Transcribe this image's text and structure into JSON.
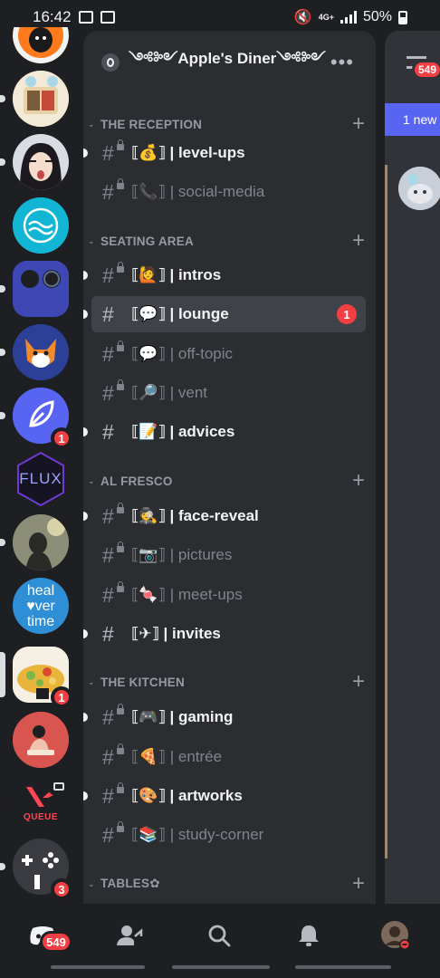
{
  "status_bar": {
    "time": "16:42",
    "network": "4G+",
    "battery": "50%"
  },
  "server": {
    "name": "༺༻Apple's Diner༺༻",
    "more_label": "•••"
  },
  "guild_badges": {
    "g7": "1",
    "g11": "1",
    "g13": "3"
  },
  "guild_texts": {
    "flux": "FLUX",
    "heal": "heal",
    "over": "♥ver",
    "time": "time",
    "queue": "QUEUE"
  },
  "categories": [
    {
      "label": "THE RECEPTION",
      "chevron": "⌄",
      "plus": "+"
    },
    {
      "label": "SEATING AREA",
      "chevron": "⌄",
      "plus": "+"
    },
    {
      "label": "AL FRESCO",
      "chevron": "⌄",
      "plus": "+"
    },
    {
      "label": "THE KITCHEN",
      "chevron": "⌄",
      "plus": "+"
    },
    {
      "label": "TABLES✿",
      "chevron": "⌄",
      "plus": "+"
    }
  ],
  "channels": [
    {
      "name": "⟦💰⟧ | level-ups",
      "hash": "#",
      "locked": true,
      "unread": true
    },
    {
      "name": "⟦📞⟧ | social-media",
      "hash": "#",
      "locked": true,
      "unread": false
    },
    {
      "name": "⟦🙋⟧ | intros",
      "hash": "#",
      "locked": true,
      "unread": true
    },
    {
      "name": "⟦💬⟧ | lounge",
      "hash": "#",
      "locked": false,
      "unread": true,
      "selected": true,
      "mentions": "1"
    },
    {
      "name": "⟦💬⟧ | off-topic",
      "hash": "#",
      "locked": true,
      "unread": false
    },
    {
      "name": "⟦🔎⟧ | vent",
      "hash": "#",
      "locked": true,
      "unread": false
    },
    {
      "name": "⟦📝⟧ | advices",
      "hash": "#",
      "locked": false,
      "unread": true
    },
    {
      "name": "⟦🕵⟧ | face-reveal",
      "hash": "#",
      "locked": true,
      "unread": true
    },
    {
      "name": "⟦📷⟧ | pictures",
      "hash": "#",
      "locked": true,
      "unread": false
    },
    {
      "name": "⟦🍬⟧ | meet-ups",
      "hash": "#",
      "locked": true,
      "unread": false
    },
    {
      "name": "⟦✈⟧ | invites",
      "hash": "#",
      "locked": false,
      "unread": true
    },
    {
      "name": "⟦🎮⟧ | gaming",
      "hash": "#",
      "locked": true,
      "unread": true
    },
    {
      "name": "⟦🍕⟧ | entrée",
      "hash": "#",
      "locked": true,
      "unread": false
    },
    {
      "name": "⟦🎨⟧ | artworks",
      "hash": "#",
      "locked": true,
      "unread": true
    },
    {
      "name": "⟦📚⟧ | study-corner",
      "hash": "#",
      "locked": true,
      "unread": false
    }
  ],
  "chat_preview": {
    "inbox_count": "549",
    "new_messages_label": "1 new"
  },
  "tab_bar": {
    "home_badge": "549"
  },
  "colors": {
    "accent": "#5865f2",
    "badge_red": "#f23f43"
  }
}
